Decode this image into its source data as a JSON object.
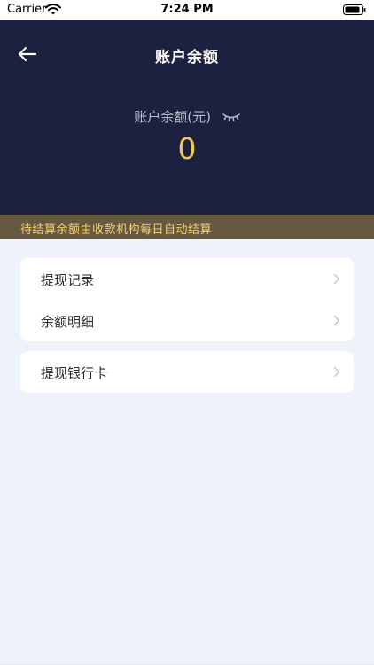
{
  "status_bar": {
    "carrier": "Carrier",
    "time": "7:24 PM"
  },
  "header": {
    "title": "账户余额"
  },
  "balance": {
    "label": "账户余额(元)",
    "value": "0"
  },
  "notice": {
    "text": "待结算余额由收款机构每日自动结算"
  },
  "menu": {
    "group1": [
      {
        "label": "提现记录"
      },
      {
        "label": "余额明细"
      }
    ],
    "group2": [
      {
        "label": "提现银行卡"
      }
    ]
  },
  "colors": {
    "header_bg": "#1d2140",
    "accent_gold": "#f1c75a",
    "notice_bg": "#66593f",
    "page_bg": "#eef3fb"
  }
}
